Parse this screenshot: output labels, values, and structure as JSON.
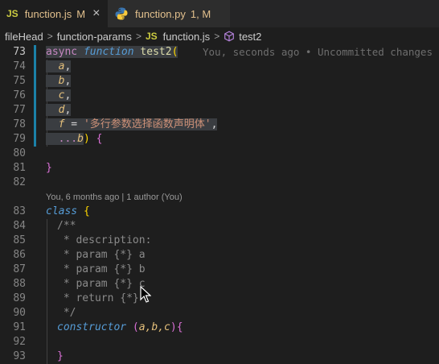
{
  "tabs": [
    {
      "icon": "js-icon",
      "icon_text": "JS",
      "name": "function.js",
      "status": "M",
      "close": "×",
      "active": true
    },
    {
      "icon": "python-icon",
      "name": "function.py",
      "status": "1, M",
      "active": false
    }
  ],
  "breadcrumb": {
    "folder1": "fileHead",
    "folder2": "function-params",
    "file_icon_text": "JS",
    "file": "function.js",
    "symbol": "test2",
    "separator": ">"
  },
  "blame_inline": "You, seconds ago • Uncommitted changes",
  "codelens": "You, 6 months ago | 1 author (You)",
  "line_numbers": [
    "73",
    "74",
    "75",
    "76",
    "77",
    "78",
    "79",
    "80",
    "81",
    "82",
    "83",
    "84",
    "85",
    "86",
    "87",
    "88",
    "89",
    "90",
    "91",
    "92",
    "93"
  ],
  "code": {
    "l73": {
      "async": "async",
      "function": "function",
      "name": "test2",
      "paren": "("
    },
    "l74": {
      "p": "a",
      "c": ","
    },
    "l75": {
      "p": "b",
      "c": ","
    },
    "l76": {
      "p": "c",
      "c": ","
    },
    "l77": {
      "p": "d",
      "c": ","
    },
    "l78": {
      "p": "f",
      "eq": " = ",
      "str": "'多行参数选择函数声明体'",
      "c": ","
    },
    "l79": {
      "spread": "...",
      "p": "b",
      "rest": ") ",
      "brace": "{"
    },
    "l81": {
      "brace": "}"
    },
    "l83": {
      "kw": "class",
      "brace": " {"
    },
    "l84": "/**",
    "l85": " * description:",
    "l86": " * param {*} a",
    "l87": " * param {*} b",
    "l88": " * param {*} c",
    "l89": " * return {*}",
    "l90": " */",
    "l91": {
      "kw": "constructor",
      "open": " (",
      "params": "a,b,c",
      "close": "){"
    },
    "l93": "}"
  },
  "colors": {
    "background": "#1e1e1e",
    "modified_tab": "#e2c08d",
    "git_change_bar": "#1b81a8"
  }
}
